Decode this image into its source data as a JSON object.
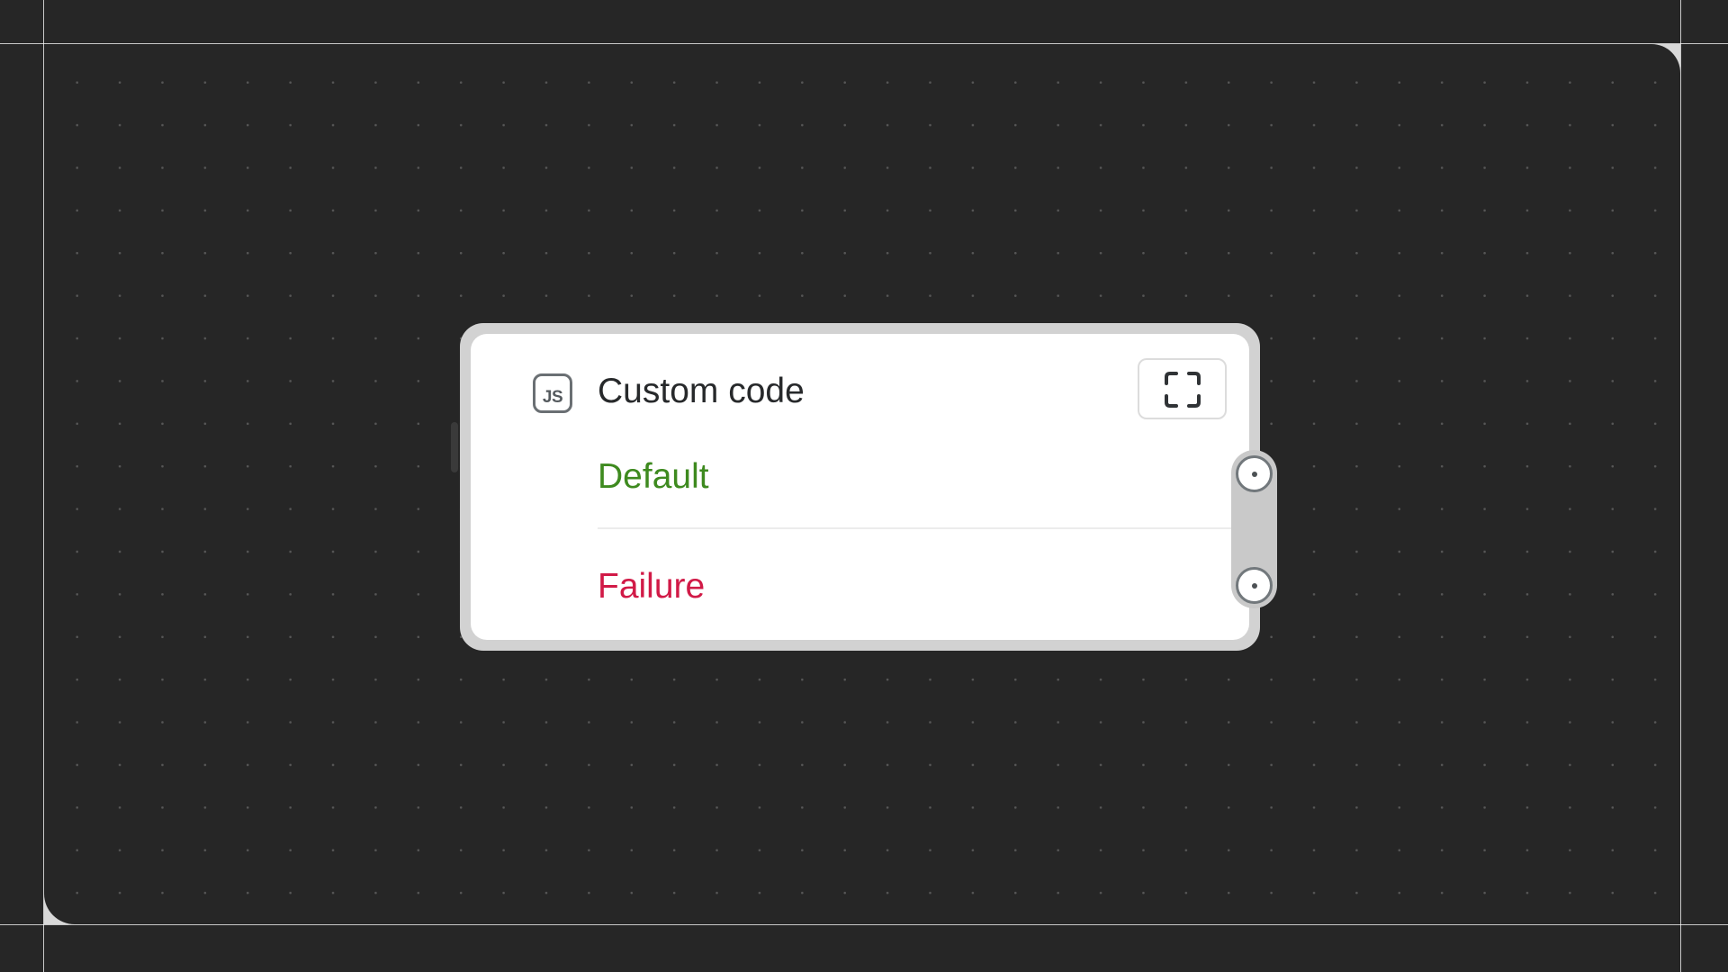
{
  "node": {
    "title": "Custom code",
    "icon": {
      "name": "js-icon",
      "text": "JS"
    },
    "expand_icon": "expand-icon",
    "outputs": [
      {
        "label": "Default",
        "color": "#3e8a1f"
      },
      {
        "label": "Failure",
        "color": "#d11a47"
      }
    ]
  },
  "colors": {
    "canvas_background": "#262626",
    "node_border": "#d2d2d2",
    "node_background": "#ffffff"
  }
}
